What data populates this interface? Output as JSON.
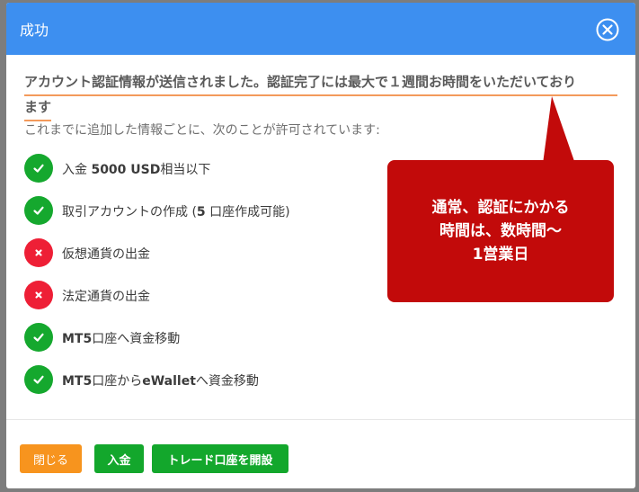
{
  "dialog": {
    "title": "成功",
    "close_icon": "close-circle-icon"
  },
  "headline": {
    "line1": "アカウント認証情報が送信されました。認証完了には最大で１週間お時間をいただいており",
    "line2": "ます"
  },
  "subtext": "これまでに追加した情報ごとに、次のことが許可されています:",
  "permissions": [
    {
      "icon": "check-icon",
      "allowed": true,
      "pre": "入金 ",
      "bold": "5000 USD",
      "post": "相当以下"
    },
    {
      "icon": "check-icon",
      "allowed": true,
      "pre": "取引アカウントの作成 (",
      "bold": "5",
      "post": " 口座作成可能)"
    },
    {
      "icon": "cross-icon",
      "allowed": false,
      "pre": "仮想通貨の出金",
      "bold": "",
      "post": ""
    },
    {
      "icon": "cross-icon",
      "allowed": false,
      "pre": "法定通貨の出金",
      "bold": "",
      "post": ""
    },
    {
      "icon": "check-icon",
      "allowed": true,
      "pre": "",
      "bold": "MT5",
      "post": "口座へ資金移動"
    },
    {
      "icon": "check-icon",
      "allowed": true,
      "pre": "",
      "bold": "MT5",
      "post": "口座から",
      "bold2": "eWallet",
      "post2": "へ資金移動"
    }
  ],
  "buttons": {
    "close": "閉じる",
    "deposit": "入金",
    "open_trade_account": "トレード口座を開設"
  },
  "callout": {
    "line1": "通常、認証にかかる",
    "line2": "時間は、数時間〜",
    "line3": "1営業日"
  },
  "colors": {
    "header": "#3d8ff0",
    "allowed": "#15a82e",
    "denied": "#ee1f36",
    "close_button": "#f7941e",
    "action_button": "#13a72c",
    "callout": "#c20a0a",
    "underline": "#f39a5b"
  }
}
